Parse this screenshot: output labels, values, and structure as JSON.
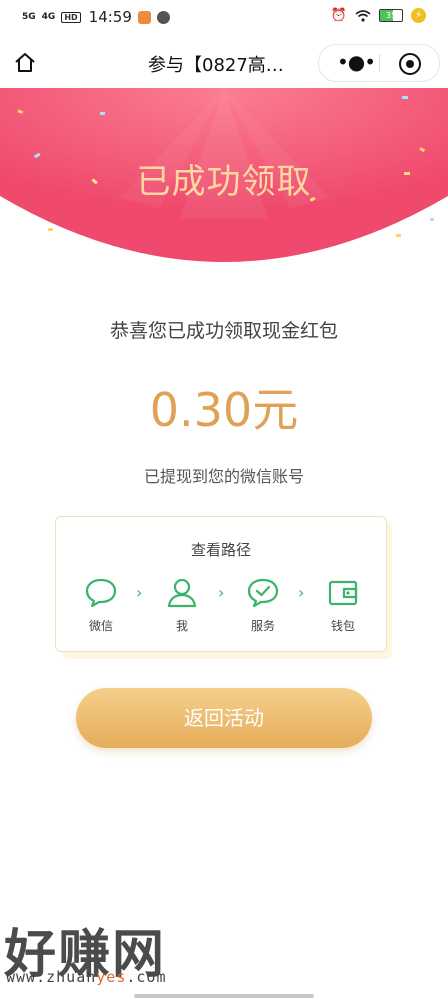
{
  "status_bar": {
    "signal1": "5G",
    "signal2": "4G",
    "hd": "HD",
    "time": "14:59",
    "battery": "35"
  },
  "nav": {
    "title": "参与【0827高…",
    "more_icon": "more-dots-icon",
    "close_icon": "target-icon",
    "home_icon": "home-icon"
  },
  "banner": {
    "title": "已成功领取",
    "color": "#f04e72"
  },
  "result": {
    "congrats": "恭喜您已成功领取现金红包",
    "amount": "0.30元",
    "desc": "已提现到您的微信账号"
  },
  "path_card": {
    "title": "查看路径",
    "steps": [
      {
        "label": "微信",
        "icon": "chat-bubble-icon"
      },
      {
        "label": "我",
        "icon": "person-icon"
      },
      {
        "label": "服务",
        "icon": "check-bubble-icon"
      },
      {
        "label": "钱包",
        "icon": "wallet-icon"
      }
    ],
    "arrow": "›",
    "accent": "#3bb46a"
  },
  "return_button": "返回活动",
  "watermark": {
    "brand": "好赚网",
    "url_prefix": "www.zhuan",
    "url_highlight": "yes",
    "url_suffix": ".com"
  }
}
